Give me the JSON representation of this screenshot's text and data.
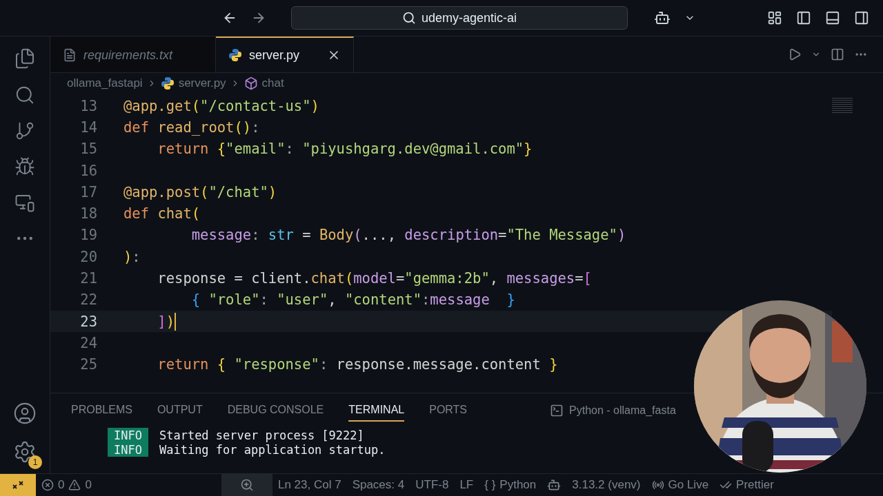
{
  "title_bar": {
    "search": "udemy-agentic-ai"
  },
  "activity_bar": {
    "settings_badge": "1"
  },
  "tabs": [
    {
      "label": "requirements.txt",
      "kind": "text",
      "selected": false
    },
    {
      "label": "server.py",
      "kind": "python",
      "selected": true
    }
  ],
  "breadcrumb": {
    "folder": "ollama_fastapi",
    "file": "server.py",
    "symbol": "chat"
  },
  "code": [
    {
      "number": "13",
      "current": false,
      "tokens": [
        {
          "color": "#e5b567",
          "t": "@app.get"
        },
        {
          "color": "#f5d33f",
          "t": "("
        },
        {
          "color": "#b5d67a",
          "t": "\"/contact-us\""
        },
        {
          "color": "#f5d33f",
          "t": ")"
        }
      ]
    },
    {
      "number": "14",
      "current": false,
      "tokens": [
        {
          "color": "#e8915a",
          "t": "def "
        },
        {
          "color": "#e5b567",
          "t": "read_root"
        },
        {
          "color": "#f5d33f",
          "t": "()"
        },
        {
          "color": "#a0a0a0",
          "t": ":"
        }
      ]
    },
    {
      "number": "15",
      "current": false,
      "tokens": [
        {
          "color": "#e8915a",
          "t": "    return "
        },
        {
          "color": "#f5d33f",
          "t": "{"
        },
        {
          "color": "#b5d67a",
          "t": "\"email\""
        },
        {
          "color": "#a0a0a0",
          "t": ": "
        },
        {
          "color": "#b5d67a",
          "t": "\"piyushgarg.dev@gmail.com\""
        },
        {
          "color": "#f5d33f",
          "t": "}"
        }
      ]
    },
    {
      "number": "16",
      "current": false
    },
    {
      "number": "17",
      "current": false,
      "tokens": [
        {
          "color": "#e5b567",
          "t": "@app.post"
        },
        {
          "color": "#f5d33f",
          "t": "("
        },
        {
          "color": "#b5d67a",
          "t": "\"/chat\""
        },
        {
          "color": "#f5d33f",
          "t": ")"
        }
      ]
    },
    {
      "number": "18",
      "current": false,
      "tokens": [
        {
          "color": "#e8915a",
          "t": "def "
        },
        {
          "color": "#e5b567",
          "t": "chat"
        },
        {
          "color": "#f5d33f",
          "t": "("
        }
      ]
    },
    {
      "number": "19",
      "current": false,
      "tokens": [
        {
          "color": "#c99de8",
          "t": "        message"
        },
        {
          "color": "#a0a0a0",
          "t": ": "
        },
        {
          "color": "#5cc0e8",
          "t": "str"
        },
        {
          "color": "#d4d4d4",
          "t": " = "
        },
        {
          "color": "#e5b567",
          "t": "Body"
        },
        {
          "color": "#c99de8",
          "t": "("
        },
        {
          "color": "#d4d4d4",
          "t": "..., "
        },
        {
          "color": "#c99de8",
          "t": "description"
        },
        {
          "color": "#d4d4d4",
          "t": "="
        },
        {
          "color": "#b5d67a",
          "t": "\"The Message\""
        },
        {
          "color": "#c99de8",
          "t": ")"
        }
      ]
    },
    {
      "number": "20",
      "current": false,
      "tokens": [
        {
          "color": "#f5d33f",
          "t": ")"
        },
        {
          "color": "#a0a0a0",
          "t": ":"
        }
      ]
    },
    {
      "number": "21",
      "current": false,
      "tokens": [
        {
          "color": "#d4d4d4",
          "t": "    response = client."
        },
        {
          "color": "#e5b567",
          "t": "chat"
        },
        {
          "color": "#f5d33f",
          "t": "("
        },
        {
          "color": "#c99de8",
          "t": "model"
        },
        {
          "color": "#d4d4d4",
          "t": "="
        },
        {
          "color": "#b5d67a",
          "t": "\"gemma:2b\""
        },
        {
          "color": "#d4d4d4",
          "t": ", "
        },
        {
          "color": "#c99de8",
          "t": "messages"
        },
        {
          "color": "#d4d4d4",
          "t": "="
        },
        {
          "color": "#d670d6",
          "t": "["
        }
      ]
    },
    {
      "number": "22",
      "current": false,
      "tokens": [
        {
          "color": "#3aa3f5",
          "t": "        { "
        },
        {
          "color": "#b5d67a",
          "t": "\"role\""
        },
        {
          "color": "#a0a0a0",
          "t": ": "
        },
        {
          "color": "#b5d67a",
          "t": "\"user\""
        },
        {
          "color": "#d4d4d4",
          "t": ", "
        },
        {
          "color": "#b5d67a",
          "t": "\"content\""
        },
        {
          "color": "#a0a0a0",
          "t": ":"
        },
        {
          "color": "#c99de8",
          "t": "message  "
        },
        {
          "color": "#3aa3f5",
          "t": "}"
        }
      ]
    },
    {
      "number": "23",
      "current": true,
      "tokens": [
        {
          "color": "#d670d6",
          "t": "    ]"
        },
        {
          "color": "#f5d33f",
          "t": ")"
        }
      ]
    },
    {
      "number": "24",
      "current": false
    },
    {
      "number": "25",
      "current": false,
      "tokens": [
        {
          "color": "#e8915a",
          "t": "    return "
        },
        {
          "color": "#f5d33f",
          "t": "{ "
        },
        {
          "color": "#b5d67a",
          "t": "\"response\""
        },
        {
          "color": "#a0a0a0",
          "t": ": "
        },
        {
          "color": "#d4d4d4",
          "t": "response.message.content "
        },
        {
          "color": "#f5d33f",
          "t": "}"
        }
      ]
    }
  ],
  "panel_tabs": [
    {
      "label": "PROBLEMS",
      "selected": false
    },
    {
      "label": "OUTPUT",
      "selected": false
    },
    {
      "label": "DEBUG CONSOLE",
      "selected": false
    },
    {
      "label": "TERMINAL",
      "selected": true
    },
    {
      "label": "PORTS",
      "selected": false
    }
  ],
  "terminal_name": "Python - ollama_fasta",
  "terminal_lines": [
    {
      "level": "INFO",
      "message": "Started server process [9222]"
    },
    {
      "level": "INFO",
      "message": "Waiting for application startup."
    }
  ],
  "status_bar": {
    "errors": "0",
    "warnings": "0",
    "position": "Ln 23, Col 7",
    "spaces": "Spaces: 4",
    "encoding": "UTF-8",
    "eol": "LF",
    "braces": "{ }",
    "language": "Python",
    "interpreter": "3.13.2 (venv)",
    "go_live": "Go Live",
    "formatter": "Prettier"
  }
}
